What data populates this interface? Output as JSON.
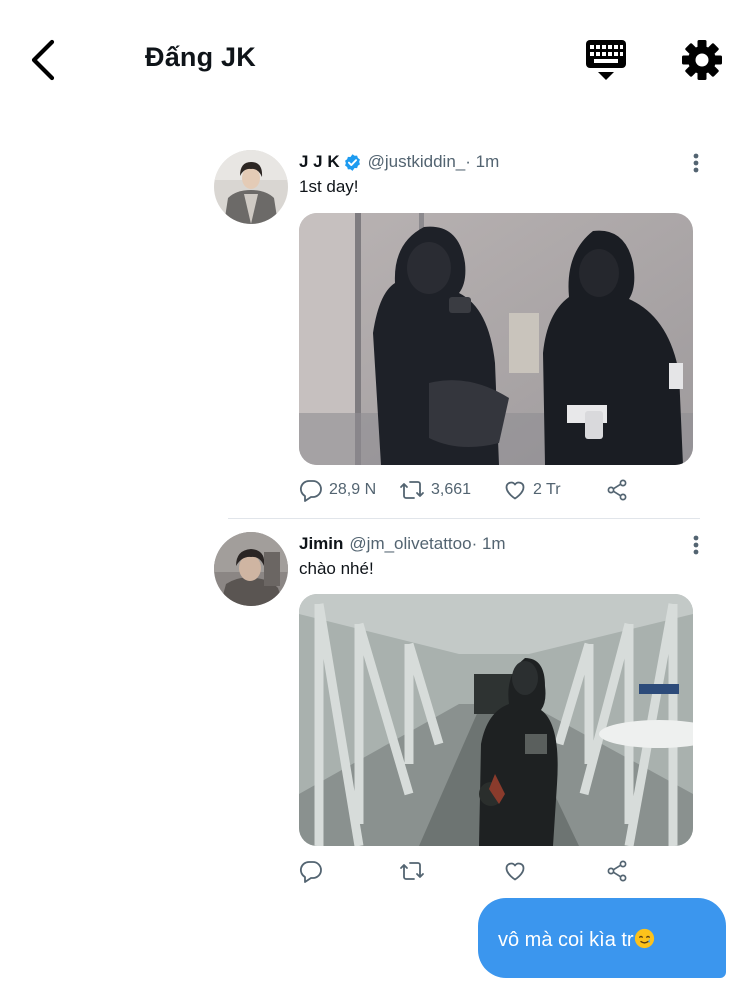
{
  "header": {
    "title": "Đấng JK",
    "icons": {
      "back": "chevron-left-icon",
      "keyboard": "keyboard-icon",
      "settings": "gear-icon"
    }
  },
  "tweets": [
    {
      "name": "J J K",
      "verified": true,
      "handle": "@justkiddin_",
      "time": " · 1m",
      "text": "1st day!",
      "media": "photo-two-hooded-people-mirror",
      "replies": "28,9 N",
      "retweets": "3,661",
      "likes": "2 Tr"
    },
    {
      "name": "Jimin",
      "verified": false,
      "handle": "@jm_olivetattoo",
      "time": " · 1m",
      "text": "chào nhé!",
      "media": "photo-airport-jet-bridge",
      "replies": "",
      "retweets": "",
      "likes": ""
    }
  ],
  "message": {
    "text": "vô mà coi kìa tr",
    "emoji": "smiling-face-with-tear-emoji"
  },
  "colors": {
    "accent": "#1d9bf0",
    "bubble": "#3b96ee",
    "muted": "#536471"
  }
}
